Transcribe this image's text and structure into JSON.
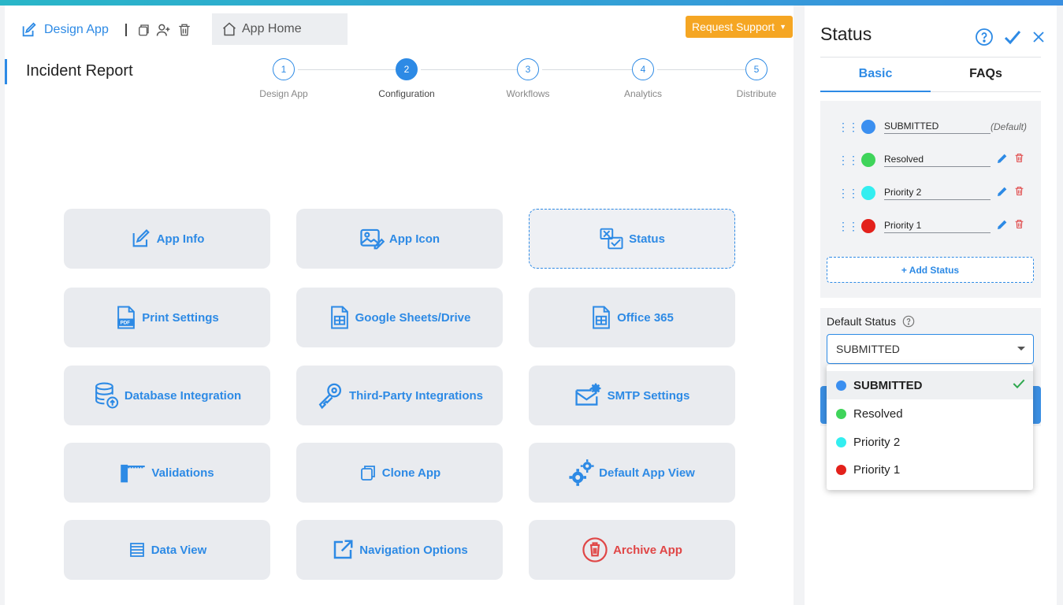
{
  "header": {
    "design_app_label": "Design App",
    "app_home_label": "App Home",
    "request_support_label": "Request Support"
  },
  "page": {
    "title": "Incident Report"
  },
  "steps": [
    {
      "number": "1",
      "label": "Design App"
    },
    {
      "number": "2",
      "label": "Configuration",
      "active": true
    },
    {
      "number": "3",
      "label": "Workflows"
    },
    {
      "number": "4",
      "label": "Analytics"
    },
    {
      "number": "5",
      "label": "Distribute"
    }
  ],
  "cards": [
    {
      "label": "App Info",
      "icon": "edit-icon"
    },
    {
      "label": "App Icon",
      "icon": "image-edit-icon"
    },
    {
      "label": "Status",
      "icon": "status-icon",
      "selected": true
    },
    {
      "label": "Print Settings",
      "icon": "pdf-icon"
    },
    {
      "label": "Google Sheets/Drive",
      "icon": "spreadsheet-icon"
    },
    {
      "label": "Office 365",
      "icon": "spreadsheet-icon"
    },
    {
      "label": "Database Integration",
      "icon": "database-icon"
    },
    {
      "label": "Third-Party Integrations",
      "icon": "key-icon"
    },
    {
      "label": "SMTP Settings",
      "icon": "mail-gear-icon"
    },
    {
      "label": "Validations",
      "icon": "ruler-icon"
    },
    {
      "label": "Clone App",
      "icon": "copy-icon"
    },
    {
      "label": "Default App View",
      "icon": "gears-icon"
    },
    {
      "label": "Data View",
      "icon": "list-icon"
    },
    {
      "label": "Navigation Options",
      "icon": "external-link-icon"
    },
    {
      "label": "Archive App",
      "icon": "trash-circle-icon",
      "danger": true
    }
  ],
  "panel": {
    "title": "Status",
    "tabs": {
      "basic": "Basic",
      "faqs": "FAQs"
    },
    "statuses": [
      {
        "name": "SUBMITTED",
        "color": "#3b8ff0",
        "default_label": "(Default)"
      },
      {
        "name": "Resolved",
        "color": "#3fd45a"
      },
      {
        "name": "Priority 2",
        "color": "#33eef0"
      },
      {
        "name": "Priority 1",
        "color": "#e3211b"
      }
    ],
    "add_status_label": "+ Add Status",
    "default_status_label": "Default Status",
    "default_status_value": "SUBMITTED",
    "dropdown_options": [
      {
        "name": "SUBMITTED",
        "color": "#3b8ff0",
        "selected": true
      },
      {
        "name": "Resolved",
        "color": "#3fd45a"
      },
      {
        "name": "Priority 2",
        "color": "#33eef0"
      },
      {
        "name": "Priority 1",
        "color": "#e3211b"
      }
    ]
  },
  "colors": {
    "accent": "#2d8ae5",
    "support_button": "#f5a623",
    "danger": "#e04646"
  }
}
